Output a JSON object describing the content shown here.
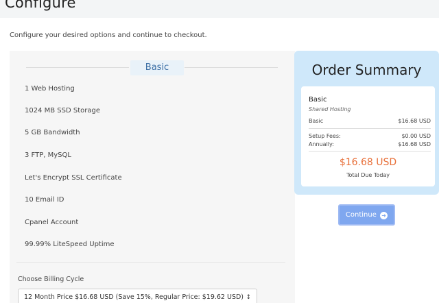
{
  "page": {
    "title": "Configure",
    "subtitle": "Configure your desired options and continue to checkout."
  },
  "product": {
    "name": "Basic",
    "features": [
      "1 Web Hosting",
      "1024 MB SSD Storage",
      "5 GB Bandwidth",
      "3 FTP, MySQL",
      "Let's Encrypt SSL Certificate",
      "10 Email ID",
      "Cpanel Account",
      "99.99% LiteSpeed Uptime"
    ]
  },
  "billing": {
    "label": "Choose Billing Cycle",
    "selected": "12 Month Price $16.68 USD (Save 15%, Regular Price: $19.62 USD)"
  },
  "summary": {
    "title": "Order Summary",
    "product_name": "Basic",
    "product_group": "Shared Hosting",
    "line_label": "Basic",
    "line_value": "$16.68 USD",
    "setup_label": "Setup Fees:",
    "setup_value": "$0.00 USD",
    "annually_label": "Annually:",
    "annually_value": "$16.68 USD",
    "total": "$16.68 USD",
    "total_label": "Total Due Today"
  },
  "actions": {
    "continue_label": "Continue",
    "continue_icon": "arrow-circle-right-icon"
  },
  "colors": {
    "summary_bg": "#cfe8fa",
    "total": "#e8703a",
    "button": "#7fa7ef",
    "product_badge": "#3a6ea5"
  }
}
